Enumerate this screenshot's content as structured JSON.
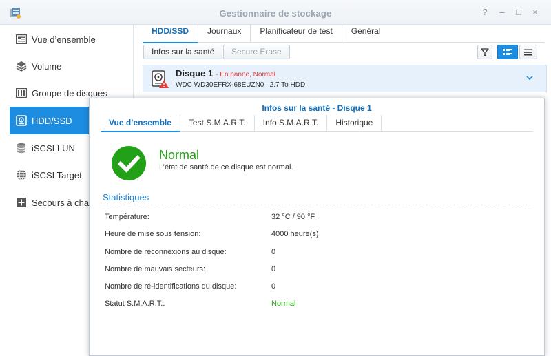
{
  "window": {
    "title": "Gestionnaire de stockage",
    "controls": [
      "?",
      "–",
      "□",
      "×"
    ]
  },
  "sidebar": {
    "items": [
      {
        "label": "Vue d’ensemble",
        "icon": "overview-icon"
      },
      {
        "label": "Volume",
        "icon": "volume-icon"
      },
      {
        "label": "Groupe de disques",
        "icon": "disk-group-icon"
      },
      {
        "label": "HDD/SSD",
        "icon": "hdd-icon",
        "active": true
      },
      {
        "label": "iSCSI LUN",
        "icon": "database-icon"
      },
      {
        "label": "iSCSI Target",
        "icon": "globe-icon"
      },
      {
        "label": "Secours à chaud",
        "icon": "plus-box-icon"
      }
    ]
  },
  "main": {
    "tabs": [
      {
        "label": "HDD/SSD",
        "active": true
      },
      {
        "label": "Journaux"
      },
      {
        "label": "Planificateur de test"
      },
      {
        "label": "Général"
      }
    ],
    "buttons": {
      "health_info": "Infos sur la santé",
      "secure_erase": "Secure Erase"
    },
    "disk": {
      "name": "Disque 1",
      "status": "- En panne, Normal",
      "model": "WDC WD30EFRX-68EUZN0 , 2.7 To HDD"
    }
  },
  "dialog": {
    "title": "Infos sur la santé - Disque 1",
    "tabs": [
      {
        "label": "Vue d’ensemble",
        "active": true
      },
      {
        "label": "Test S.M.A.R.T."
      },
      {
        "label": "Info S.M.A.R.T."
      },
      {
        "label": "Historique"
      }
    ],
    "health": {
      "status": "Normal",
      "description": "L’état de santé de ce disque est normal."
    },
    "stats_title": "Statistiques",
    "stats": [
      {
        "label": "Température:",
        "value": "32 °C / 90 °F"
      },
      {
        "label": "Heure de mise sous tension:",
        "value": "4000 heure(s)"
      },
      {
        "label": "Nombre de reconnexions au disque:",
        "value": "0"
      },
      {
        "label": "Nombre de mauvais secteurs:",
        "value": "0"
      },
      {
        "label": "Nombre de ré-identifications du disque:",
        "value": "0"
      },
      {
        "label": "Statut S.M.A.R.T.:",
        "value": "Normal"
      }
    ]
  },
  "colors": {
    "accent": "#1c8de0",
    "success": "#27a117",
    "error": "#e33b3b"
  }
}
